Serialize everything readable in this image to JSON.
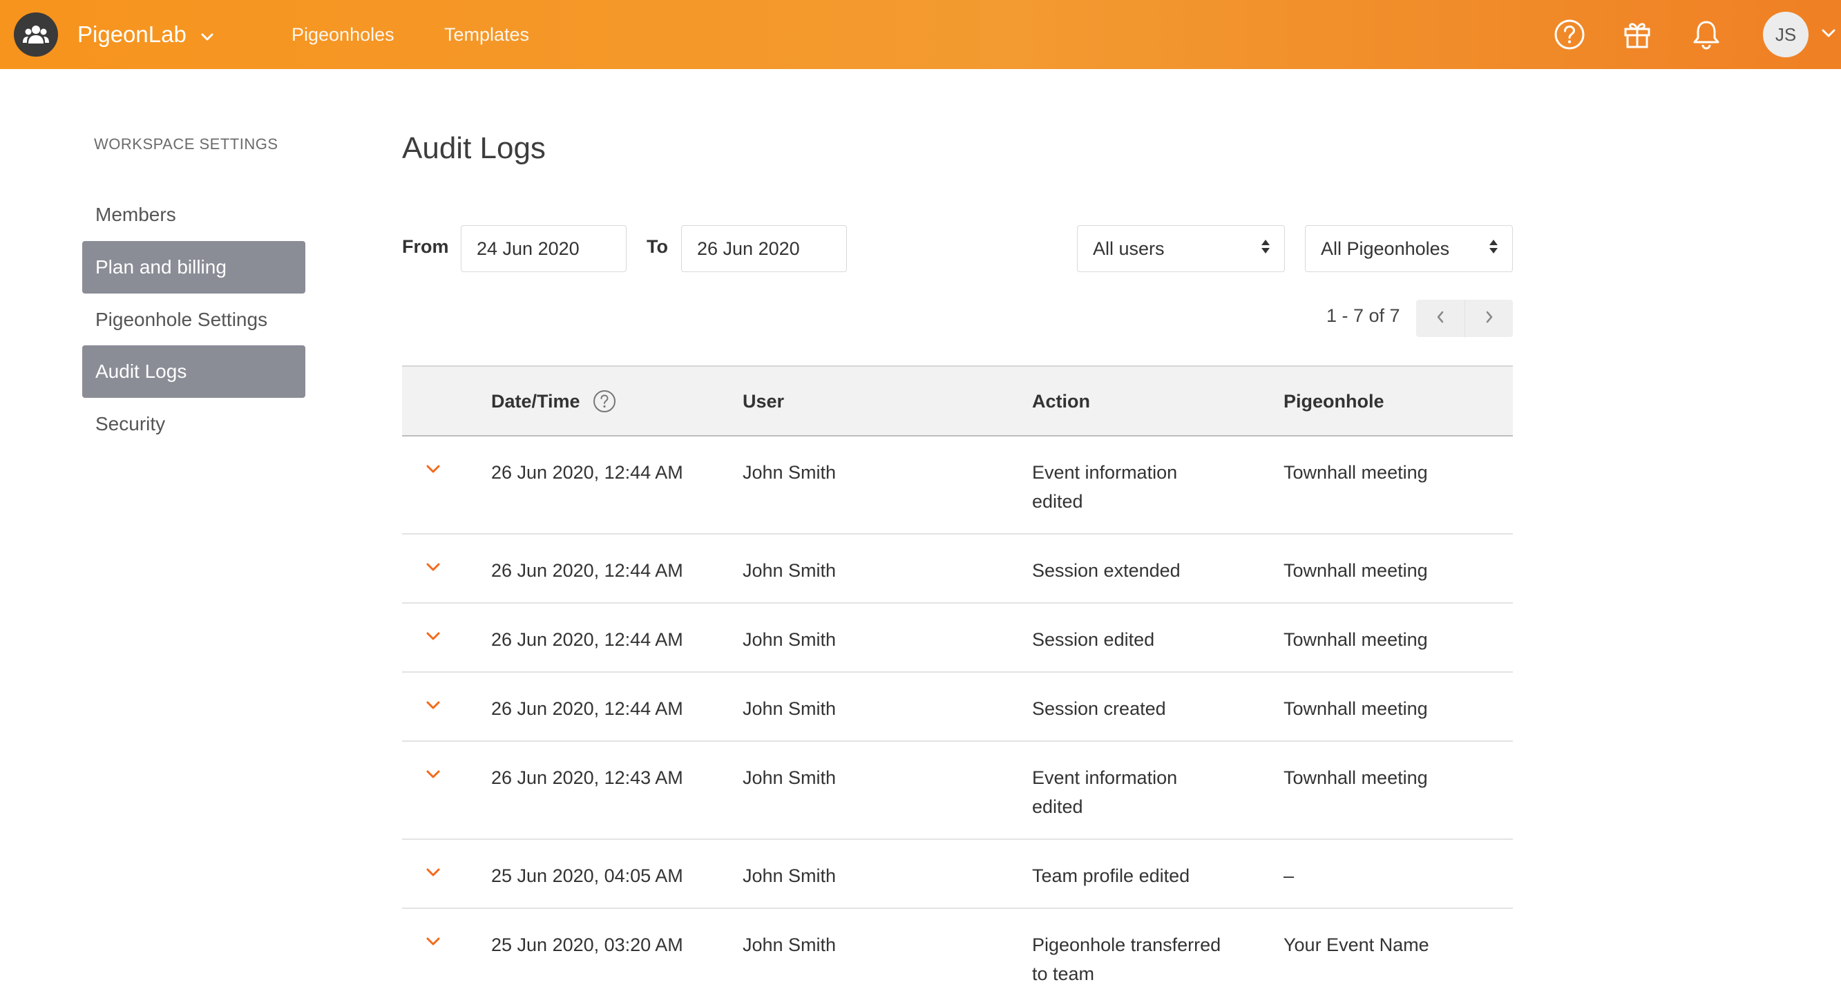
{
  "header": {
    "brand": "PigeonLab",
    "nav": [
      "Pigeonholes",
      "Templates"
    ],
    "avatar_initials": "JS",
    "icons": [
      "users-group-icon",
      "help-circle-icon",
      "gift-icon",
      "bell-icon",
      "chevron-down-icon"
    ],
    "brand_color": "#f7941d"
  },
  "sidebar": {
    "heading": "WORKSPACE SETTINGS",
    "items": [
      {
        "label": "Members",
        "active": false
      },
      {
        "label": "Plan and billing",
        "active": true
      },
      {
        "label": "Pigeonhole Settings",
        "active": false
      },
      {
        "label": "Audit Logs",
        "active": true
      },
      {
        "label": "Security",
        "active": false
      }
    ],
    "active_color": "#8a8c96"
  },
  "main": {
    "title": "Audit Logs",
    "filters": {
      "from_label": "From",
      "from_value": "24 Jun 2020",
      "to_label": "To",
      "to_value": "26 Jun 2020",
      "users_select": "All users",
      "pigeonholes_select": "All Pigeonholes"
    },
    "pagination": {
      "text": "1 - 7 of 7"
    },
    "table": {
      "columns": [
        "Date/Time",
        "User",
        "Action",
        "Pigeonhole"
      ],
      "rows": [
        {
          "datetime": "26 Jun 2020, 12:44 AM",
          "user": "John Smith",
          "action": [
            "Event information",
            "edited"
          ],
          "pigeonhole": "Townhall meeting"
        },
        {
          "datetime": "26 Jun 2020, 12:44 AM",
          "user": "John Smith",
          "action": [
            "Session extended"
          ],
          "pigeonhole": "Townhall meeting"
        },
        {
          "datetime": "26 Jun 2020, 12:44 AM",
          "user": "John Smith",
          "action": [
            "Session edited"
          ],
          "pigeonhole": "Townhall meeting"
        },
        {
          "datetime": "26 Jun 2020, 12:44 AM",
          "user": "John Smith",
          "action": [
            "Session created"
          ],
          "pigeonhole": "Townhall meeting"
        },
        {
          "datetime": "26 Jun 2020, 12:43 AM",
          "user": "John Smith",
          "action": [
            "Event information",
            "edited"
          ],
          "pigeonhole": "Townhall meeting"
        },
        {
          "datetime": "25 Jun 2020, 04:05 AM",
          "user": "John Smith",
          "action": [
            "Team profile edited"
          ],
          "pigeonhole": "–"
        },
        {
          "datetime": "25 Jun 2020, 03:20 AM",
          "user": "John Smith",
          "action": [
            "Pigeonhole transferred",
            "to team"
          ],
          "pigeonhole": "Your Event Name"
        }
      ],
      "caret_color": "#f26b1d"
    }
  }
}
